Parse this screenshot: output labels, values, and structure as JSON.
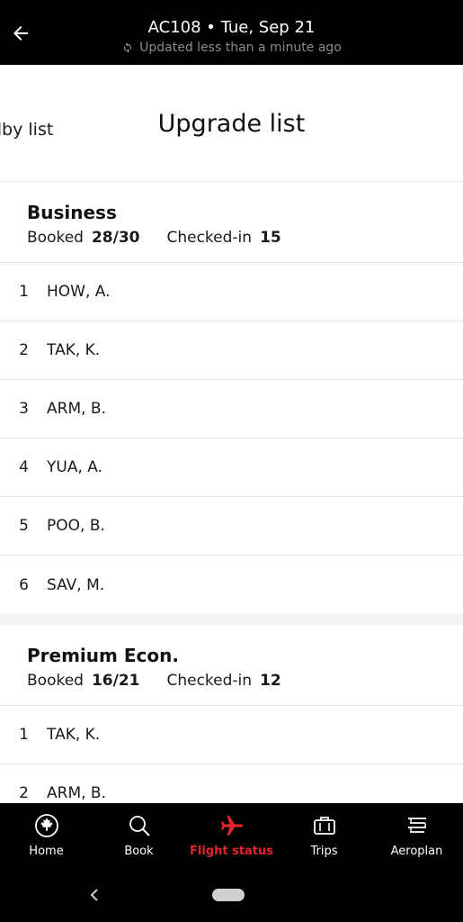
{
  "header": {
    "title": "AC108 • Tue, Sep 21",
    "updated": "Updated less than a minute ago"
  },
  "tabs": {
    "standby": "dby list",
    "upgrade": "Upgrade list"
  },
  "sections": [
    {
      "title": "Business",
      "booked_label": "Booked",
      "booked_value": "28/30",
      "checked_label": "Checked-in",
      "checked_value": "15",
      "rows": [
        {
          "num": "1",
          "name": "HOW, A."
        },
        {
          "num": "2",
          "name": "TAK, K."
        },
        {
          "num": "3",
          "name": "ARM, B."
        },
        {
          "num": "4",
          "name": "YUA, A."
        },
        {
          "num": "5",
          "name": "POO, B."
        },
        {
          "num": "6",
          "name": "SAV, M."
        }
      ]
    },
    {
      "title": "Premium Econ.",
      "booked_label": "Booked",
      "booked_value": "16/21",
      "checked_label": "Checked-in",
      "checked_value": "12",
      "rows": [
        {
          "num": "1",
          "name": "TAK, K."
        },
        {
          "num": "2",
          "name": "ARM, B."
        }
      ]
    }
  ],
  "nav": {
    "items": [
      {
        "label": "Home",
        "icon": "maple-leaf-icon"
      },
      {
        "label": "Book",
        "icon": "search-icon"
      },
      {
        "label": "Flight status",
        "icon": "plane-icon"
      },
      {
        "label": "Trips",
        "icon": "briefcase-icon"
      },
      {
        "label": "Aeroplan",
        "icon": "aeroplan-icon"
      }
    ],
    "active_color": "#e5232f"
  }
}
